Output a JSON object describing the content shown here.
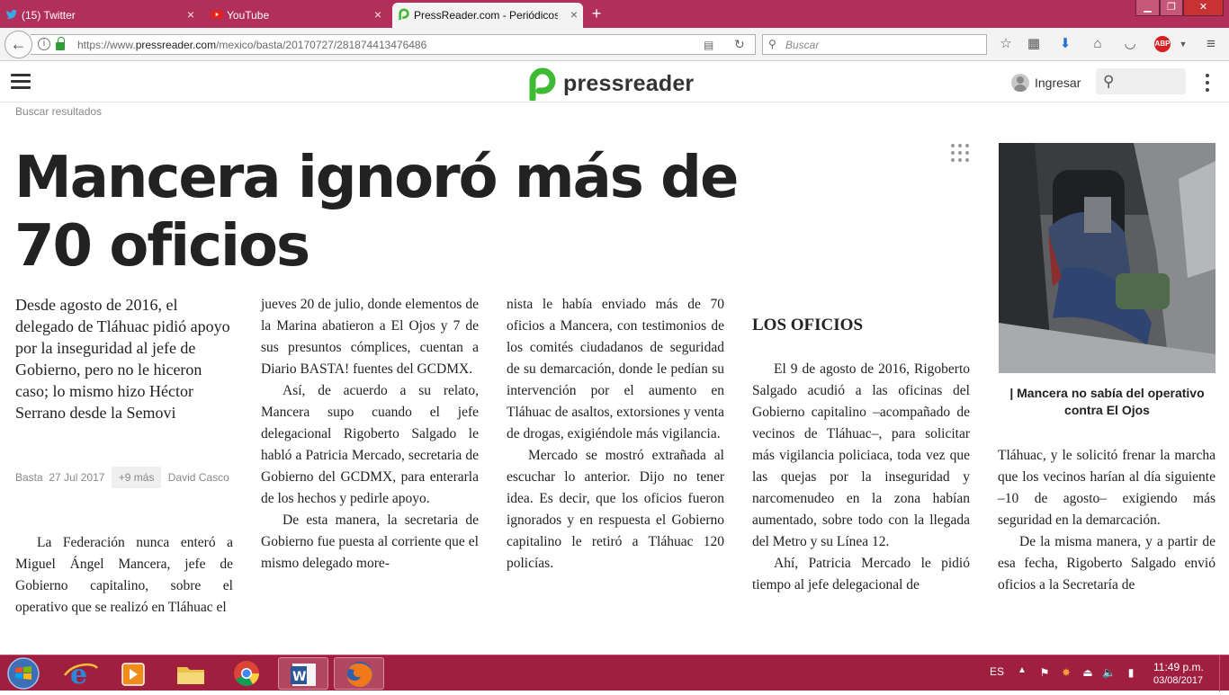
{
  "browser": {
    "tabs": [
      {
        "label": "(15) Twitter",
        "icon": "twitter-icon",
        "color": "#1da1f2"
      },
      {
        "label": "YouTube",
        "icon": "youtube-icon",
        "color": "#e62117"
      },
      {
        "label": "PressReader.com - Periódicos",
        "icon": "pressreader-icon",
        "color": "#3fba35"
      }
    ],
    "url_prefix": "https://www.",
    "url_host": "pressreader.com",
    "url_path": "/mexico/basta/20170727/281874413476486",
    "search_placeholder": "Buscar",
    "abp_label": "ABP"
  },
  "site": {
    "logo_text": "pressreader",
    "login_label": "Ingresar",
    "search_results_label": "Buscar resultados",
    "brand_color": "#3fba35"
  },
  "article": {
    "headline": "Mancera ignoró más de 70 oficios",
    "deck": "Desde agosto de 2016, el delegado de Tláhuac pidió apoyo por la inseguridad al jefe de Gobierno, pero no le hiceron caso; lo mismo hizo Héctor Serrano desde la Semovi",
    "meta": {
      "source": "Basta",
      "date": "27 Jul 2017",
      "more": "+9 más",
      "author": "David Casco"
    },
    "col1": [
      "La Federación nunca enteró a Miguel Ángel Mancera, jefe de Gobierno capitalino, sobre el operativo que se realizó en Tláhuac el"
    ],
    "col2": [
      "jueves 20 de julio, donde elementos de la Marina abatieron a El Ojos y 7 de sus presuntos cómplices, cuentan a Diario BASTA! fuentes del GCDMX.",
      "Así, de acuerdo a su relato, Mancera supo cuando el jefe delegacional Rigoberto Salgado le habló a Patricia Mercado, secretaria de Gobierno del GCDMX, para enterarla de los hechos y pedirle apoyo.",
      "De esta manera, la secretaria de Gobierno fue puesta al corriente que el mismo delegado more-"
    ],
    "col3": [
      "nista le había enviado más de 70 oficios a Mancera, con testimonios de los comités ciudadanos de seguridad de su demarcación, donde le pedían su intervención por el aumento en Tláhuac de asaltos, extorsiones y venta de drogas, exigiéndole más vigilancia.",
      "Mercado se mostró extrañada al escuchar lo anterior. Dijo no tener idea. Es decir, que los oficios fueron ignorados y en respuesta el Gobierno capitalino le retiró a Tláhuac 120 policías."
    ],
    "subhead": "LOS OFICIOS",
    "col4": [
      "El 9 de agosto de 2016, Rigoberto Salgado acudió a las oficinas del Gobierno capitalino –acompañado de vecinos de Tláhuac–, para solicitar más vigilancia policiaca, toda vez que las quejas por la inseguridad y narcomenudeo en la zona habían aumentado, sobre todo con la llegada del Metro y su Línea 12.",
      "Ahí, Patricia Mercado le pidió tiempo al jefe delegacional de"
    ],
    "caption": "| Mancera no sabía del operativo contra El Ojos",
    "col5": [
      "Tláhuac, y le solicitó frenar la marcha que los vecinos harían al día siguiente –10 de agosto– exigiendo más seguridad en la demarcación.",
      "De la misma manera, y a partir de esa fecha, Rigoberto Salgado envió oficios a la Secretaría de"
    ]
  },
  "taskbar": {
    "apps": [
      "internet-explorer",
      "media-player",
      "file-explorer",
      "chrome",
      "word",
      "firefox"
    ],
    "language": "ES",
    "time": "11:49 p.m.",
    "date": "03/08/2017"
  }
}
